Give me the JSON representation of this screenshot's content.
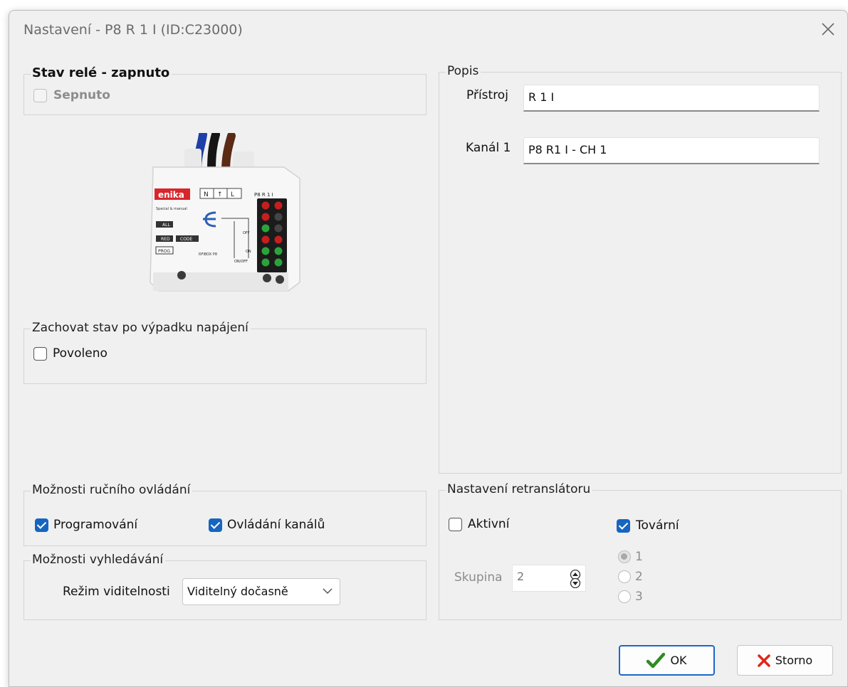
{
  "window": {
    "title": "Nastavení - P8 R 1 I (ID:C23000)"
  },
  "relay_state": {
    "legend": "Stav relé - zapnuto",
    "checkbox_label": "Sepnuto",
    "checked": false
  },
  "device_image": {
    "brand": "enika",
    "model": "P8 R 1 I",
    "terminal_labels": [
      "N",
      "↑",
      "L"
    ],
    "side_labels": [
      "Special & manual",
      "ALL",
      "RED",
      "CODE",
      "PROG",
      "OFF",
      "ON",
      "ON/OFF",
      "RFIBOX P8"
    ]
  },
  "power_loss": {
    "legend": "Zachovat stav po výpadku napájení",
    "checkbox_label": "Povoleno",
    "checked": false
  },
  "manual_control": {
    "legend": "Možnosti ručního ovládání",
    "programming_label": "Programování",
    "programming_checked": true,
    "channels_label": "Ovládání kanálů",
    "channels_checked": true
  },
  "search_options": {
    "legend": "Možnosti vyhledávání",
    "visibility_label": "Režim viditelnosti",
    "visibility_value": "Viditelný dočasně"
  },
  "description": {
    "legend": "Popis",
    "device_label": "Přístroj",
    "device_value": "R 1 I",
    "channel_label": "Kanál 1",
    "channel_value": "P8 R1 I - CH 1"
  },
  "repeater": {
    "legend": "Nastavení retranslátoru",
    "active_label": "Aktivní",
    "active_checked": false,
    "factory_label": "Tovární",
    "factory_checked": true,
    "group_label": "Skupina",
    "group_value": "2",
    "radio_options": [
      "1",
      "2",
      "3"
    ],
    "radio_selected": "1"
  },
  "buttons": {
    "ok_label": "OK",
    "cancel_label": "Storno"
  },
  "colors": {
    "accent": "#1665c1",
    "dialog_bg": "#f0f0f0",
    "ok_green": "#2e8b1f",
    "cancel_red": "#e0251b",
    "brand_red": "#d8262c"
  }
}
